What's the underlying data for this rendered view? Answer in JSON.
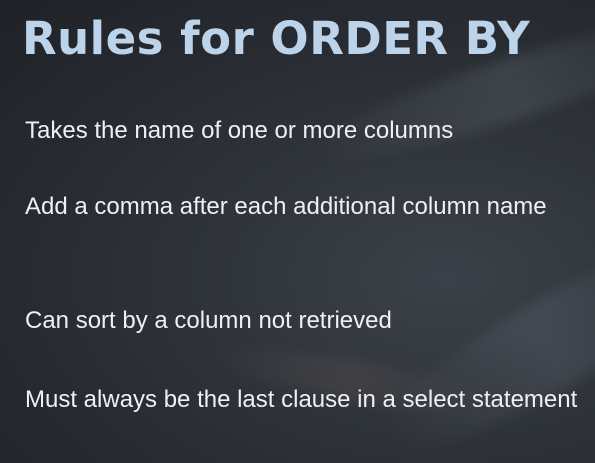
{
  "slide": {
    "title": "Rules for ORDER BY",
    "bullets": [
      "Takes the name of one or more columns",
      "Add a comma after each additional column name",
      "Can sort by a column not retrieved",
      "Must always be the last clause in a select statement"
    ]
  },
  "colors": {
    "title": "#bcd3ea",
    "text": "#eef0f2",
    "background": "#2b2f35"
  }
}
